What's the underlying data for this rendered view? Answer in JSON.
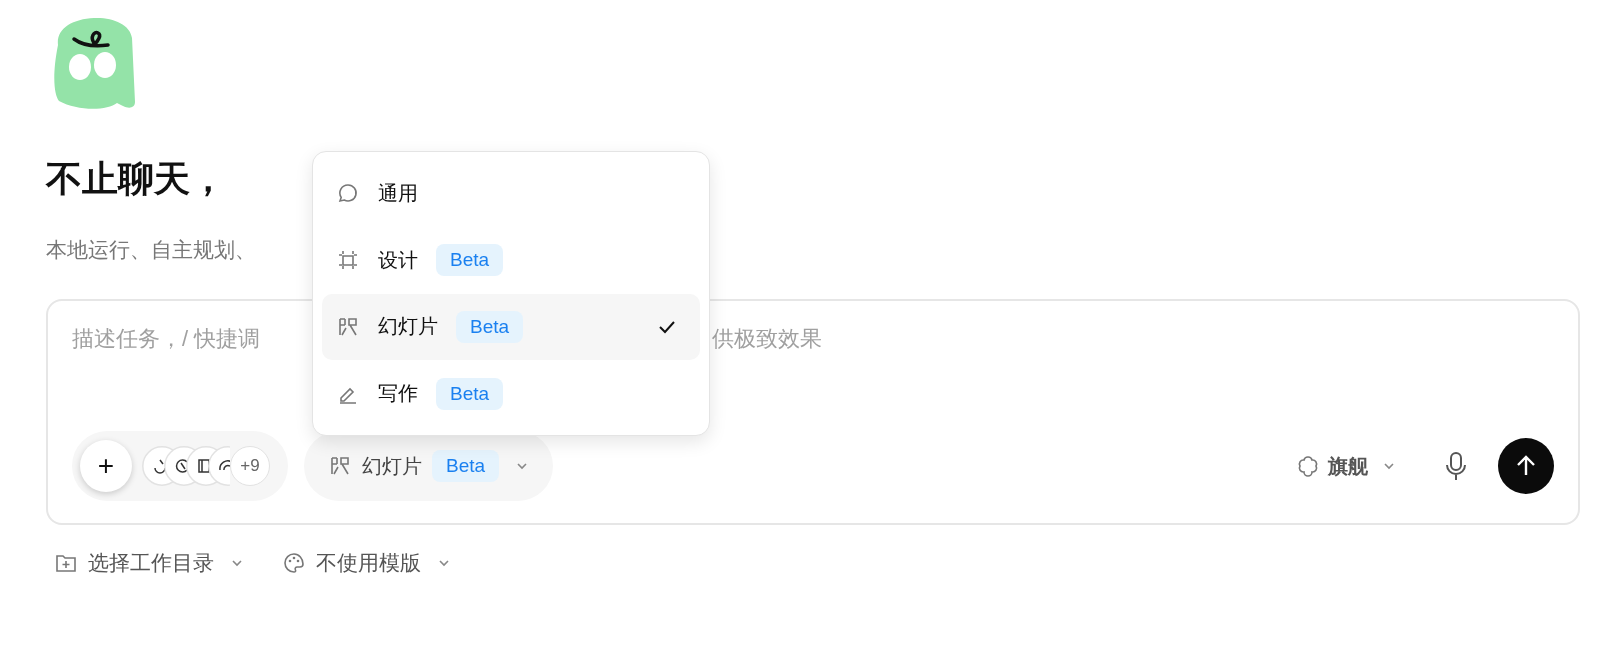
{
  "heading": "不止聊天，",
  "subheading": "本地运行、自主规划、",
  "composer": {
    "placeholder_start": "描述任务，/ 快捷调",
    "placeholder_end": "供极致效果",
    "add_button": "+",
    "connectors_more": "+9",
    "mode": {
      "kind": "slides",
      "label": "幻灯片",
      "badge": "Beta"
    },
    "model": {
      "label": "旗舰"
    }
  },
  "footer": [
    {
      "kind": "folder",
      "label": "选择工作目录"
    },
    {
      "kind": "palette",
      "label": "不使用模版"
    }
  ],
  "mode_menu": [
    {
      "kind": "chat",
      "label": "通用",
      "selected": false
    },
    {
      "kind": "frame",
      "label": "设计",
      "badge": "Beta",
      "selected": false
    },
    {
      "kind": "slides",
      "label": "幻灯片",
      "badge": "Beta",
      "selected": true
    },
    {
      "kind": "pen",
      "label": "写作",
      "badge": "Beta",
      "selected": false
    }
  ]
}
